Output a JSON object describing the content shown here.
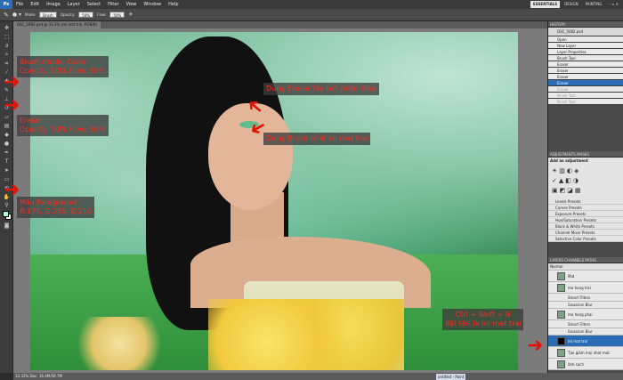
{
  "menubar": {
    "logo": "Ps",
    "items": [
      "File",
      "Edit",
      "Image",
      "Layer",
      "Select",
      "Filter",
      "View",
      "Window",
      "Help"
    ],
    "workspaces": [
      {
        "label": "ESSENTIALS",
        "active": true
      },
      {
        "label": "DESIGN",
        "active": false
      },
      {
        "label": "PAINTING",
        "active": false
      }
    ]
  },
  "options": {
    "mode_label": "Mode:",
    "mode_value": "Brush",
    "opacity_label": "Opacity:",
    "opacity_value": "50%",
    "flow_label": "Flow:",
    "flow_value": "50%"
  },
  "document": {
    "tab_label": "DSC_5082.psd @ 33.3% (mi mat trai, RGB/8)",
    "status": "33.33%    Doc: 16.4M/59.7M"
  },
  "annotations": {
    "brush": "Brush mode: Color\nOpacity: 50% Flow: 50%",
    "eraser": "Eraser\nOpacity: 50% Flow: 50%",
    "fg_color": "Mầu Foreground\nR:175, G:255, B:210",
    "eraser_step": "Dùng Eraser tẩy bớt phần thừa",
    "brush_step": "Dùng Brush tô lê mi mat trai",
    "shortcut": "Ctrl + Shift + N\nđặt tên là mi mat trai"
  },
  "history": {
    "title": "HISTORY",
    "snapshot": "DSC_5082.psd",
    "items": [
      {
        "label": "Open",
        "sel": false,
        "dim": false
      },
      {
        "label": "New Layer",
        "sel": false,
        "dim": false
      },
      {
        "label": "Layer Properties",
        "sel": false,
        "dim": false
      },
      {
        "label": "Brush Tool",
        "sel": false,
        "dim": false
      },
      {
        "label": "Eraser",
        "sel": false,
        "dim": false
      },
      {
        "label": "Eraser",
        "sel": false,
        "dim": false
      },
      {
        "label": "Eraser",
        "sel": false,
        "dim": false
      },
      {
        "label": "Eraser",
        "sel": true,
        "dim": false
      },
      {
        "label": "Eraser",
        "sel": false,
        "dim": true
      },
      {
        "label": "Brush Tool",
        "sel": false,
        "dim": true
      },
      {
        "label": "Brush Tool",
        "sel": false,
        "dim": true
      }
    ]
  },
  "adjustments": {
    "title": "ADJUSTMENTS   MASKS",
    "add_label": "Add an adjustment",
    "presets": [
      "Levels Presets",
      "Curves Presets",
      "Exposure Presets",
      "Hue/Saturation Presets",
      "Black & White Presets",
      "Channel Mixer Presets",
      "Selective Color Presets"
    ]
  },
  "layers": {
    "title": "LAYERS   CHANNELS   PATHS",
    "blend": "Normal",
    "items": [
      {
        "label": "Mat",
        "type": "normal",
        "sel": false
      },
      {
        "label": "mo hong trai",
        "type": "normal",
        "sel": false
      },
      {
        "label": "Smart Filters",
        "type": "filter",
        "sel": false
      },
      {
        "label": "Gaussian Blur",
        "type": "filter",
        "sel": false
      },
      {
        "label": "mo hong phai",
        "type": "normal",
        "sel": false
      },
      {
        "label": "Smart Filters",
        "type": "filter",
        "sel": false
      },
      {
        "label": "Gaussian Blur",
        "type": "filter",
        "sel": false
      },
      {
        "label": "mi mat trai",
        "type": "black",
        "sel": true
      },
      {
        "label": "Tạo giảm mọi nhat mat",
        "type": "normal",
        "sel": false
      },
      {
        "label": "làm sạch",
        "type": "normal",
        "sel": false
      }
    ]
  },
  "taskbar_title": "untitled - Paint",
  "colors": {
    "foreground": "#afffd2",
    "accent": "#2a6db5",
    "annotation_text": "#ff2a1f",
    "arrow": "#e1140a"
  }
}
